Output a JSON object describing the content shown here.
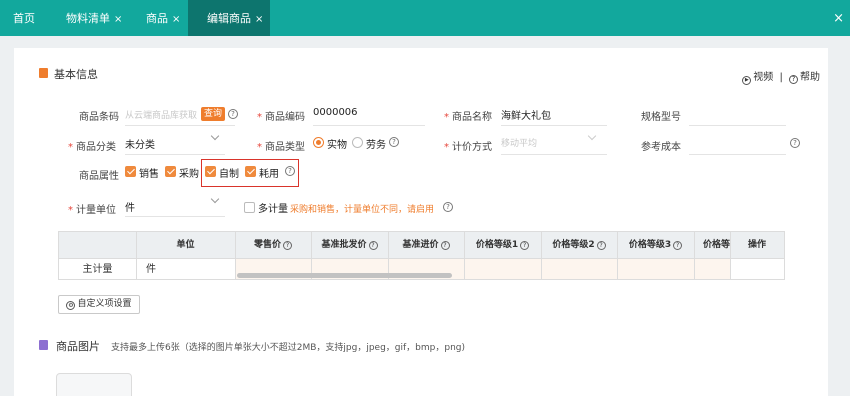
{
  "tabs": [
    {
      "label": "首页",
      "closable": false,
      "active": false
    },
    {
      "label": "物料清单",
      "closable": true,
      "active": false
    },
    {
      "label": "商品",
      "closable": true,
      "active": false
    },
    {
      "label": "编辑商品",
      "closable": true,
      "active": true
    }
  ],
  "close_glyph": "×",
  "window_close": "×",
  "colors": {
    "topbar": "#12a89d",
    "active_tab": "#0d756e",
    "accent_orange": "#ef7d2d",
    "required_red": "#e6463c",
    "highlight_box": "#d9342b"
  },
  "basic_info": {
    "title": "基本信息",
    "video_link": "视频",
    "separator": "|",
    "help_link": "帮助",
    "barcode": {
      "label": "商品条码",
      "placeholder": "从云端商品库获取",
      "query_button": "查询"
    },
    "code": {
      "label": "商品编码",
      "value": "0000006"
    },
    "name": {
      "label": "商品名称",
      "value": "海鲜大礼包"
    },
    "spec": {
      "label": "规格型号",
      "value": ""
    },
    "category": {
      "label": "商品分类",
      "value": "未分类"
    },
    "type": {
      "label": "商品类型",
      "options": [
        "实物",
        "劳务"
      ],
      "selected": "实物"
    },
    "pricing": {
      "label": "计价方式",
      "placeholder": "移动平均"
    },
    "ref_cost": {
      "label": "参考成本",
      "value": ""
    },
    "attributes": {
      "label": "商品属性",
      "options": [
        {
          "label": "销售",
          "checked": true
        },
        {
          "label": "采购",
          "checked": true
        },
        {
          "label": "自制",
          "checked": true
        },
        {
          "label": "耗用",
          "checked": true
        }
      ]
    },
    "unit": {
      "label": "计量单位",
      "value": "件"
    },
    "multi_unit": {
      "label": "多计量",
      "checked": false,
      "note": "采购和销售，计量单位不同，请启用"
    }
  },
  "price_table": {
    "headers": [
      "单位",
      "零售价",
      "基准批发价",
      "基准进价",
      "价格等级1",
      "价格等级2",
      "价格等级3",
      "价格等",
      "操作"
    ],
    "row": {
      "type": "主计量",
      "unit": "件"
    }
  },
  "custom_button": "自定义项设置",
  "images_section": {
    "title": "商品图片",
    "note": "支持最多上传6张（选择的图片单张大小不超过2MB，支持jpg，jpeg，gif，bmp，png)"
  },
  "icons": [
    "doc-icon",
    "play-icon",
    "help-icon",
    "question-icon",
    "chevron-down-icon",
    "gear-icon",
    "image-icon",
    "close-icon"
  ]
}
